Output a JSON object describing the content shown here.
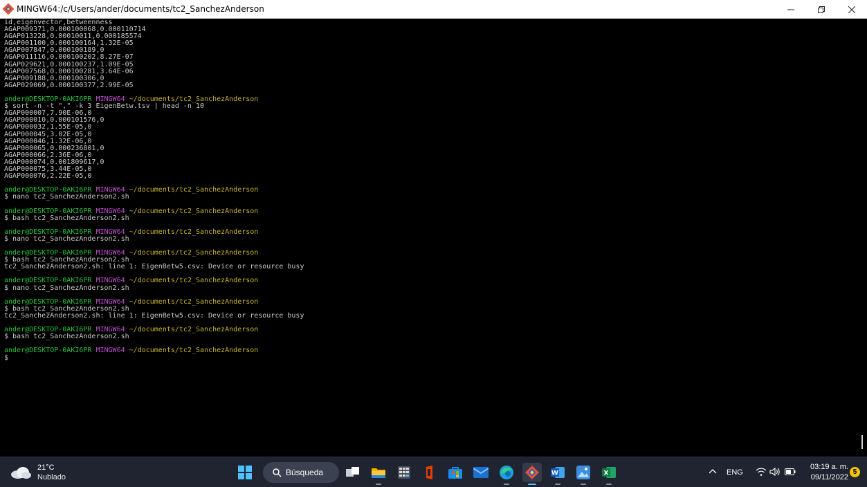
{
  "window": {
    "title": "MINGW64:/c/Users/ander/documents/tc2_SanchezAnderson",
    "minimize_icon": "minimize-icon",
    "maximize_icon": "restore-icon",
    "close_icon": "close-icon"
  },
  "terminal": {
    "prompt_user": "ander@DESKTOP-0AKI6PR",
    "prompt_shell": "MINGW64",
    "prompt_path": "~/documents/tc2_SanchezAnderson",
    "lines": [
      {
        "t": "out",
        "text": "id,eigenvector,betweenness"
      },
      {
        "t": "out",
        "text": "AGAP009371,0.000100068,0.000110714"
      },
      {
        "t": "out",
        "text": "AGAP013228,0.00010011,0.000185574"
      },
      {
        "t": "out",
        "text": "AGAP001100,0.000100164,1.32E-05"
      },
      {
        "t": "out",
        "text": "AGAP007847,0.000100189,0"
      },
      {
        "t": "out",
        "text": "AGAP011116,0.000100202,8.27E-07"
      },
      {
        "t": "out",
        "text": "AGAP029621,0.000100237,1.09E-05"
      },
      {
        "t": "out",
        "text": "AGAP007568,0.000100281,3.64E-06"
      },
      {
        "t": "out",
        "text": "AGAP009188,0.000100306,0"
      },
      {
        "t": "out",
        "text": "AGAP029069,0.000100377,2.99E-05"
      },
      {
        "t": "blank",
        "text": ""
      },
      {
        "t": "prompt",
        "text": ""
      },
      {
        "t": "out",
        "text": "$ sort -n -t \",\" -k 3 EigenBetw.tsv | head -n 10"
      },
      {
        "t": "out",
        "text": "AGAP000007,7.90E-06,0"
      },
      {
        "t": "out",
        "text": "AGAP000010,0.000101576,0"
      },
      {
        "t": "out",
        "text": "AGAP000032,1.55E-05,0"
      },
      {
        "t": "out",
        "text": "AGAP000045,3.02E-05,0"
      },
      {
        "t": "out",
        "text": "AGAP000046,1.32E-06,0"
      },
      {
        "t": "out",
        "text": "AGAP000065,0.000236801,0"
      },
      {
        "t": "out",
        "text": "AGAP000066,2.36E-06,0"
      },
      {
        "t": "out",
        "text": "AGAP000074,0.001809617,0"
      },
      {
        "t": "out",
        "text": "AGAP000075,3.44E-05,0"
      },
      {
        "t": "out",
        "text": "AGAP000076,2.22E-05,0"
      },
      {
        "t": "blank",
        "text": ""
      },
      {
        "t": "prompt",
        "text": ""
      },
      {
        "t": "out",
        "text": "$ nano tc2_SanchezAnderson2.sh"
      },
      {
        "t": "blank",
        "text": ""
      },
      {
        "t": "prompt",
        "text": ""
      },
      {
        "t": "out",
        "text": "$ bash tc2_SanchezAnderson2.sh"
      },
      {
        "t": "blank",
        "text": ""
      },
      {
        "t": "prompt",
        "text": ""
      },
      {
        "t": "out",
        "text": "$ nano tc2_SanchezAnderson2.sh"
      },
      {
        "t": "blank",
        "text": ""
      },
      {
        "t": "prompt",
        "text": ""
      },
      {
        "t": "out",
        "text": "$ bash tc2_SanchezAnderson2.sh"
      },
      {
        "t": "out",
        "text": "tc2_SanchezAnderson2.sh: line 1: EigenBetw5.csv: Device or resource busy"
      },
      {
        "t": "blank",
        "text": ""
      },
      {
        "t": "prompt",
        "text": ""
      },
      {
        "t": "out",
        "text": "$ nano tc2_SanchezAnderson2.sh"
      },
      {
        "t": "blank",
        "text": ""
      },
      {
        "t": "prompt",
        "text": ""
      },
      {
        "t": "out",
        "text": "$ bash tc2_SanchezAnderson2.sh"
      },
      {
        "t": "out",
        "text": "tc2_SanchezAnderson2.sh: line 1: EigenBetw5.csv: Device or resource busy"
      },
      {
        "t": "blank",
        "text": ""
      },
      {
        "t": "prompt",
        "text": ""
      },
      {
        "t": "out",
        "text": "$ bash tc2_SanchezAnderson2.sh"
      },
      {
        "t": "blank",
        "text": ""
      },
      {
        "t": "prompt",
        "text": ""
      },
      {
        "t": "out",
        "text": "$"
      }
    ]
  },
  "taskbar": {
    "weather": {
      "temp": "21°C",
      "condition": "Nublado",
      "icon": "cloud-icon"
    },
    "search_label": "Búsqueda",
    "apps": [
      {
        "name": "start-button",
        "icon": "windows-logo-icon"
      },
      {
        "name": "task-view-button",
        "icon": "task-view-icon"
      },
      {
        "name": "file-explorer-button",
        "icon": "folder-icon"
      },
      {
        "name": "calculator-button",
        "icon": "calculator-icon"
      },
      {
        "name": "office-button",
        "icon": "office-icon"
      },
      {
        "name": "store-button",
        "icon": "store-icon"
      },
      {
        "name": "mail-button",
        "icon": "mail-icon"
      },
      {
        "name": "edge-button",
        "icon": "edge-icon"
      },
      {
        "name": "git-bash-button",
        "icon": "git-icon"
      },
      {
        "name": "word-button",
        "icon": "word-icon"
      },
      {
        "name": "photos-button",
        "icon": "photos-icon"
      },
      {
        "name": "excel-button",
        "icon": "excel-icon"
      }
    ],
    "tray": {
      "language": "ENG",
      "time": "03:19 a. m.",
      "date": "09/11/2022",
      "notification_count": "5"
    }
  },
  "colors": {
    "prompt_user": "#24c43a",
    "prompt_shell": "#c34fd1",
    "prompt_path": "#c8b42a",
    "text": "#c8c8c8",
    "taskbar": "#1f2430"
  }
}
